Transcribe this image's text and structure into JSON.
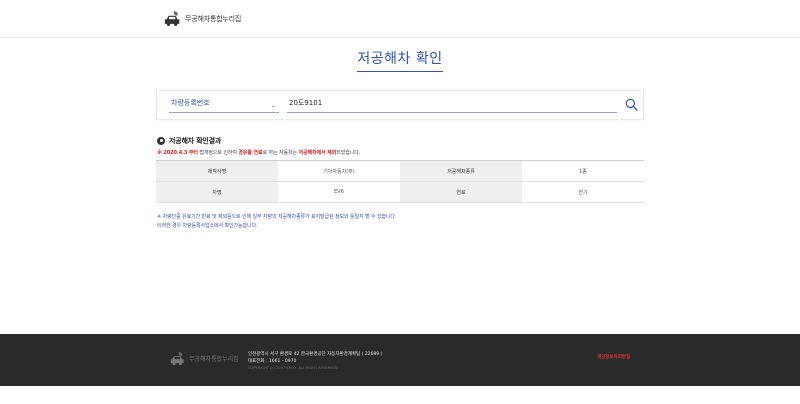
{
  "header": {
    "logo_text": "무공해차통합누리집"
  },
  "page": {
    "title": "저공해차 확인"
  },
  "search": {
    "select_value": "차량등록번호",
    "input_value": "20도9101"
  },
  "result": {
    "heading": "저공해차 확인결과",
    "notice": {
      "prefix": "※ ",
      "date": "2020.4.3 부터",
      "middle1": " 법개정으로 인하여 ",
      "fuel": "경유를 연료",
      "middle2": "로 하는 자동차는 ",
      "exclude": "저공해차에서 제외",
      "suffix": "되었습니다."
    },
    "table": {
      "row1": {
        "h1": "제작사명",
        "v1": "기아자동차(주)",
        "h2": "저공해차종류",
        "v2": "1종"
      },
      "row2": {
        "h1": "차명",
        "v1": "EV6",
        "h2": "연료",
        "v2": "전기"
      }
    },
    "notes": [
      "※ 차량인증 유효기간 만료 및 제외등으로 인해 일부 차량의 저공해차종류가 표지발급된 정보와 틀릴지 할 수 있습니다.",
      "이러한 경우 차량등록사업소에서 확인가능합니다."
    ]
  },
  "footer": {
    "logo_text": "무공해차통합누리집",
    "address": "인천광역시 서구 환경로 42 한국환경공단 자동차환경계획팀 ( 22689 )",
    "phone": "대표전화 : 1661 - 0970",
    "copyright": "COPYRIGHT (c) 2017 KECO. ALL RIGHT RESERVED.",
    "privacy": "개인정보처리방침"
  },
  "colors": {
    "accent": "#2e55a8",
    "warning": "#d6202a",
    "footer_bg": "#2a2a2a"
  },
  "icons": {
    "logo": "car-leaf-icon",
    "select_arrow": "chevron-down-icon",
    "search": "search-icon",
    "result_bullet": "record-bullet-icon"
  }
}
